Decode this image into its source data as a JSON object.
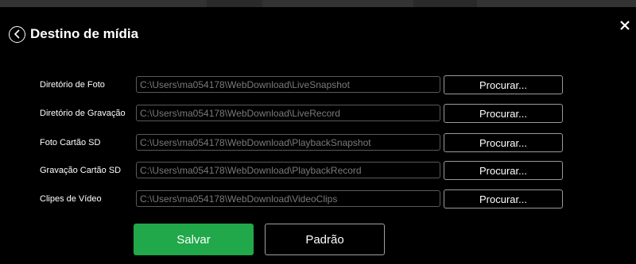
{
  "dialog": {
    "title": "Destino de mídia",
    "back_icon": "chevron-left-circle-icon",
    "close_icon": "close-icon",
    "close_glyph": "×"
  },
  "rows": [
    {
      "label": "Diretório de Foto",
      "path": "C:\\Users\\ma054178\\WebDownload\\LiveSnapshot",
      "button": "Procurar..."
    },
    {
      "label": "Diretório de Gravação",
      "path": "C:\\Users\\ma054178\\WebDownload\\LiveRecord",
      "button": "Procurar..."
    },
    {
      "label": "Foto Cartão SD",
      "path": "C:\\Users\\ma054178\\WebDownload\\PlaybackSnapshot",
      "button": "Procurar..."
    },
    {
      "label": "Gravação Cartão SD",
      "path": "C:\\Users\\ma054178\\WebDownload\\PlaybackRecord",
      "button": "Procurar..."
    },
    {
      "label": "Clipes de Vídeo",
      "path": "C:\\Users\\ma054178\\WebDownload\\VideoClips",
      "button": "Procurar..."
    }
  ],
  "actions": {
    "save_label": "Salvar",
    "default_label": "Padrão"
  },
  "colors": {
    "background": "#000000",
    "save_button": "#20a84a",
    "field_text": "#7a7a7a",
    "field_border": "#5a5a5a"
  }
}
